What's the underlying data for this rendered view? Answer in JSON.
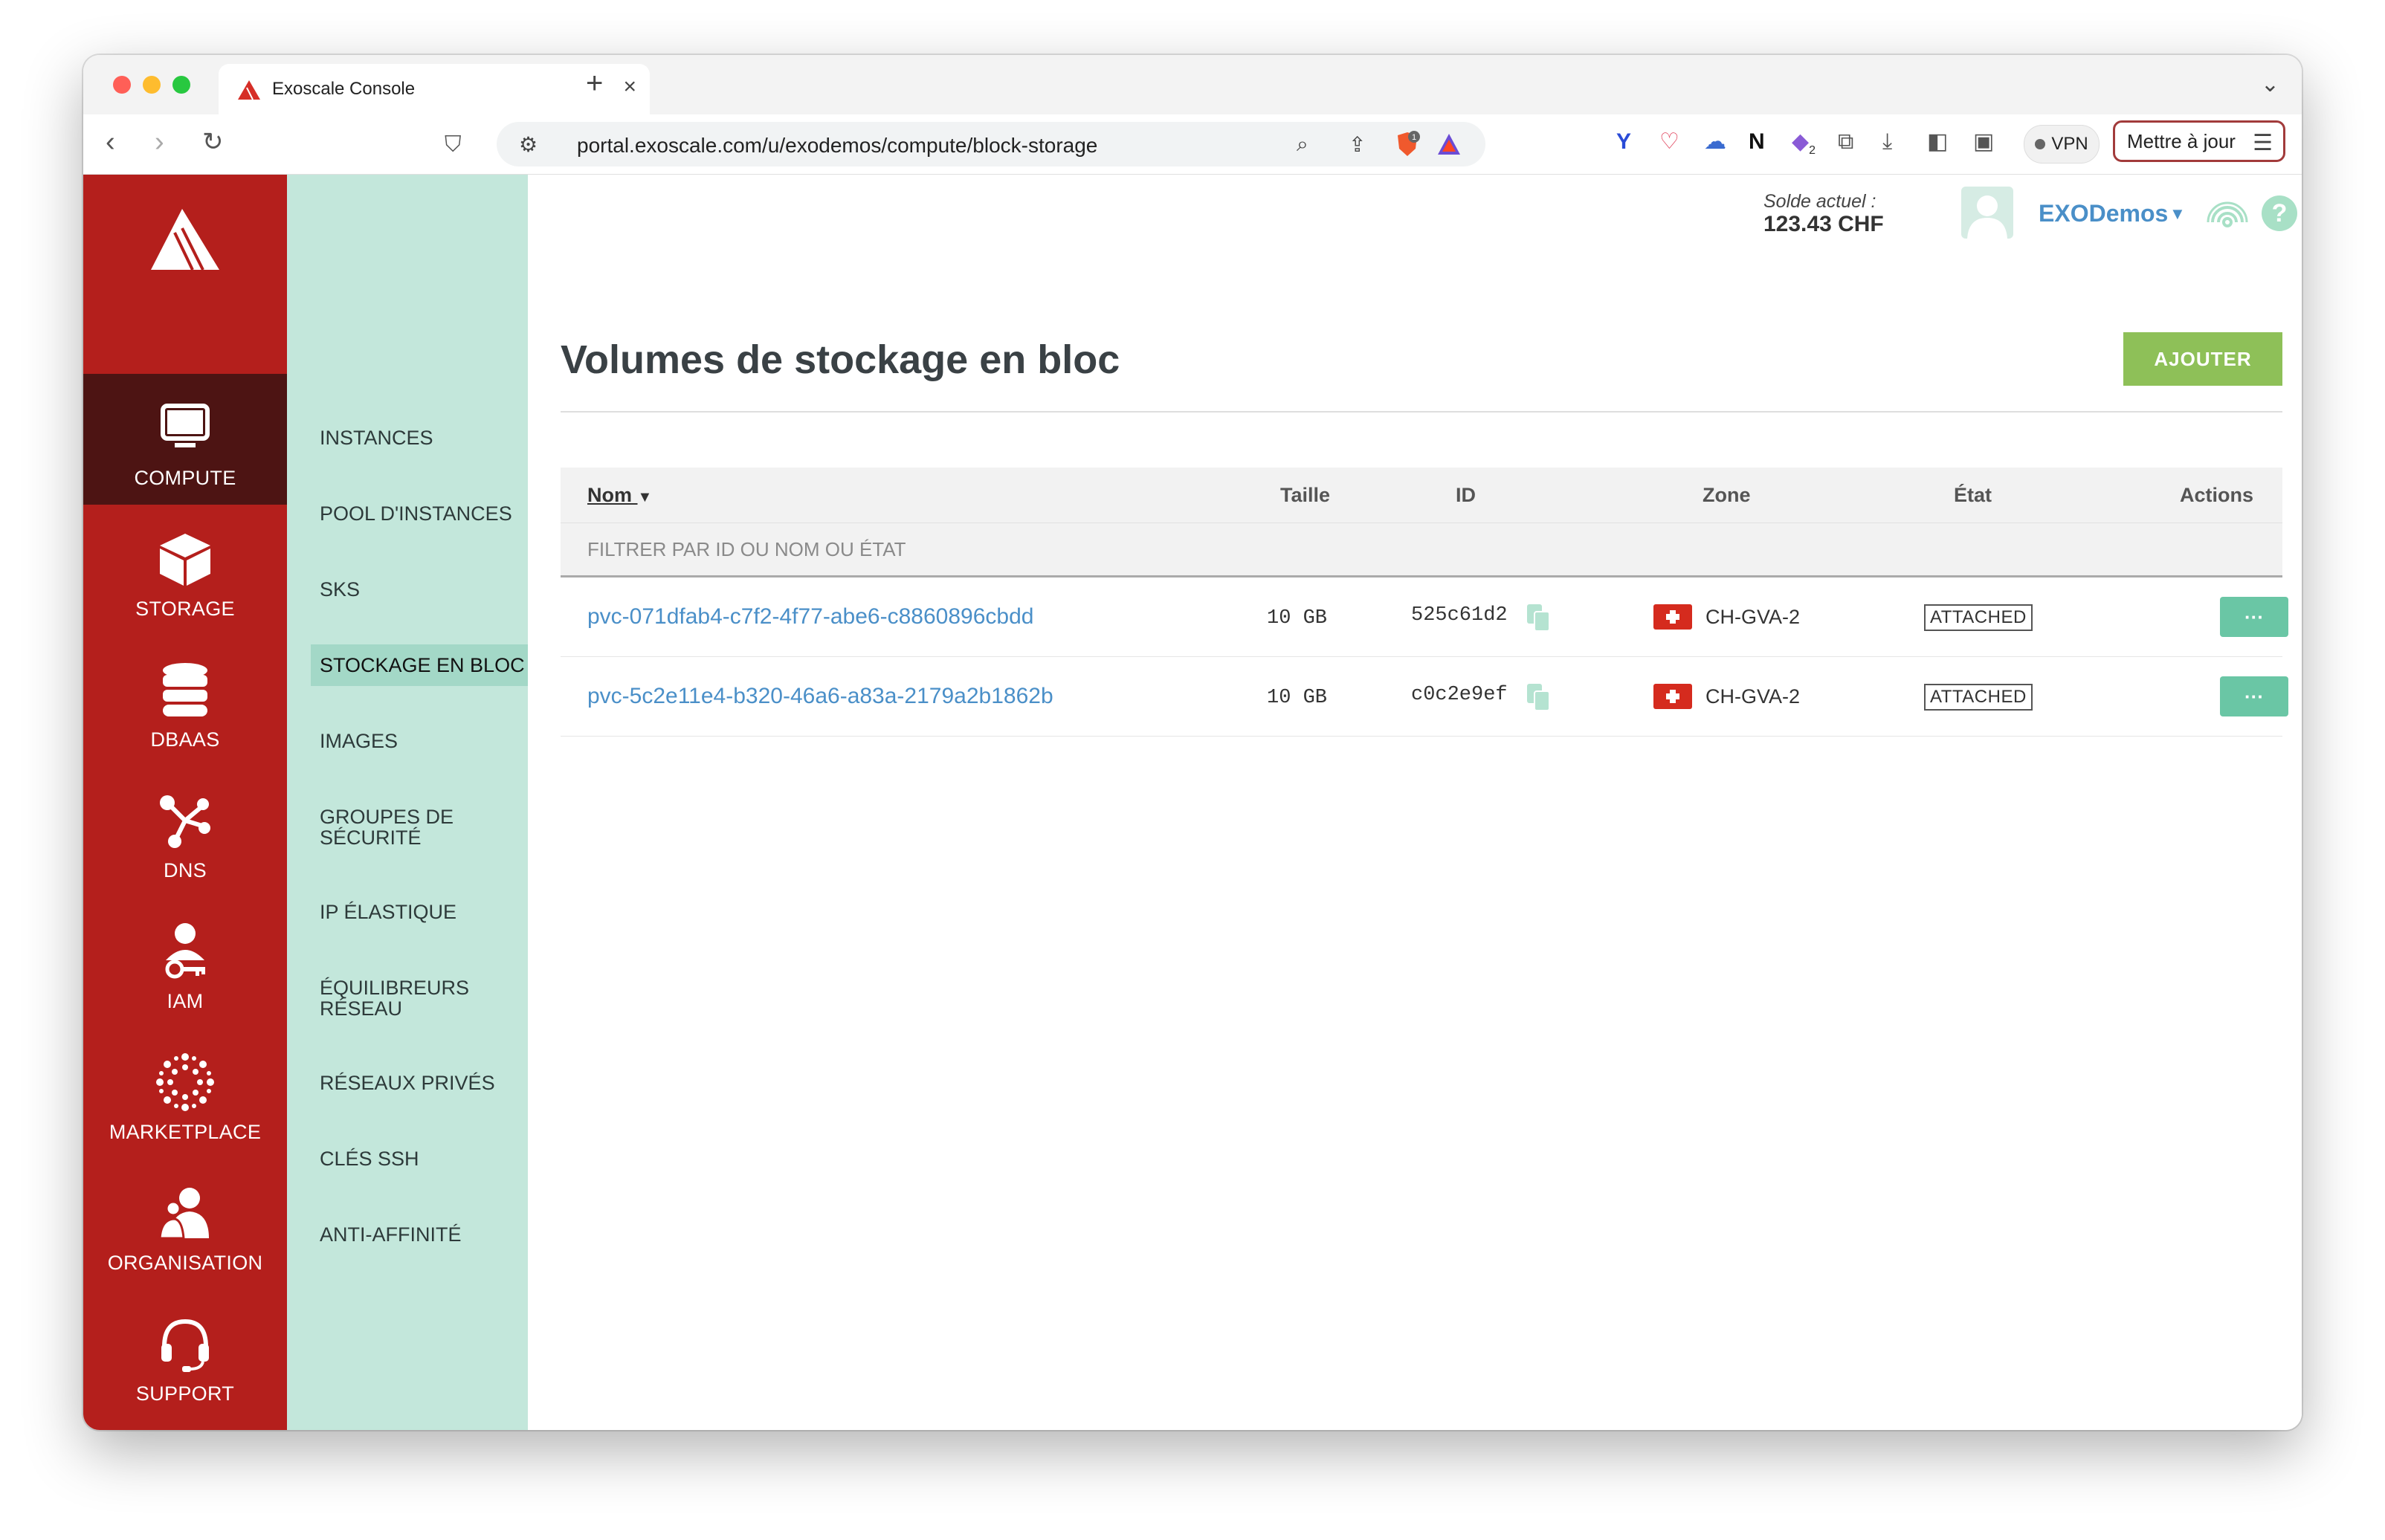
{
  "browser": {
    "tab_title": "Exoscale Console",
    "new_tab_symbol": "+",
    "url": "portal.exoscale.com/u/exodemos/compute/block-storage",
    "vpn_label": "VPN",
    "update_label": "Mettre à jour",
    "brave_badge": "1",
    "ext_badge": "2"
  },
  "rail": {
    "items": [
      {
        "label": "COMPUTE",
        "icon": "monitor-icon"
      },
      {
        "label": "STORAGE",
        "icon": "cube-icon"
      },
      {
        "label": "DBAAS",
        "icon": "database-icon"
      },
      {
        "label": "DNS",
        "icon": "network-icon"
      },
      {
        "label": "IAM",
        "icon": "user-key-icon"
      },
      {
        "label": "MARKETPLACE",
        "icon": "dots-burst-icon"
      },
      {
        "label": "ORGANISATION",
        "icon": "users-icon"
      },
      {
        "label": "SUPPORT",
        "icon": "headset-icon"
      }
    ],
    "active": "COMPUTE"
  },
  "subnav": {
    "items": [
      "INSTANCES",
      "POOL D'INSTANCES",
      "SKS",
      "STOCKAGE EN BLOC",
      "IMAGES",
      "GROUPES DE SÉCURITÉ",
      "IP ÉLASTIQUE",
      "ÉQUILIBREURS RÉSEAU",
      "RÉSEAUX PRIVÉS",
      "CLÉS SSH",
      "ANTI-AFFINITÉ"
    ],
    "active": "STOCKAGE EN BLOC"
  },
  "header": {
    "balance_label": "Solde actuel :",
    "balance_value": "123.43 CHF",
    "account_name": "EXODemos",
    "help_symbol": "?"
  },
  "page": {
    "title": "Volumes de stockage en bloc",
    "add_button": "AJOUTER"
  },
  "table": {
    "columns": {
      "name": "Nom",
      "size": "Taille",
      "id": "ID",
      "zone": "Zone",
      "state": "État",
      "actions": "Actions"
    },
    "filter_placeholder": "FILTRER PAR ID OU NOM OU ÉTAT",
    "rows": [
      {
        "name": "pvc-071dfab4-c7f2-4f77-abe6-c8860896cbdd",
        "size": "10 GB",
        "id": "525c61d2",
        "zone": "CH-GVA-2",
        "state": "ATTACHED",
        "actions": "···"
      },
      {
        "name": "pvc-5c2e11e4-b320-46a6-a83a-2179a2b1862b",
        "size": "10 GB",
        "id": "c0c2e9ef",
        "zone": "CH-GVA-2",
        "state": "ATTACHED",
        "actions": "···"
      }
    ]
  },
  "colors": {
    "rail": "#b41f1c",
    "rail_active": "#4d1413",
    "subnav": "#c3e7db",
    "accent_green": "#8ec058",
    "actions_teal": "#6ac6a5",
    "link_blue": "#4a8fc8"
  }
}
